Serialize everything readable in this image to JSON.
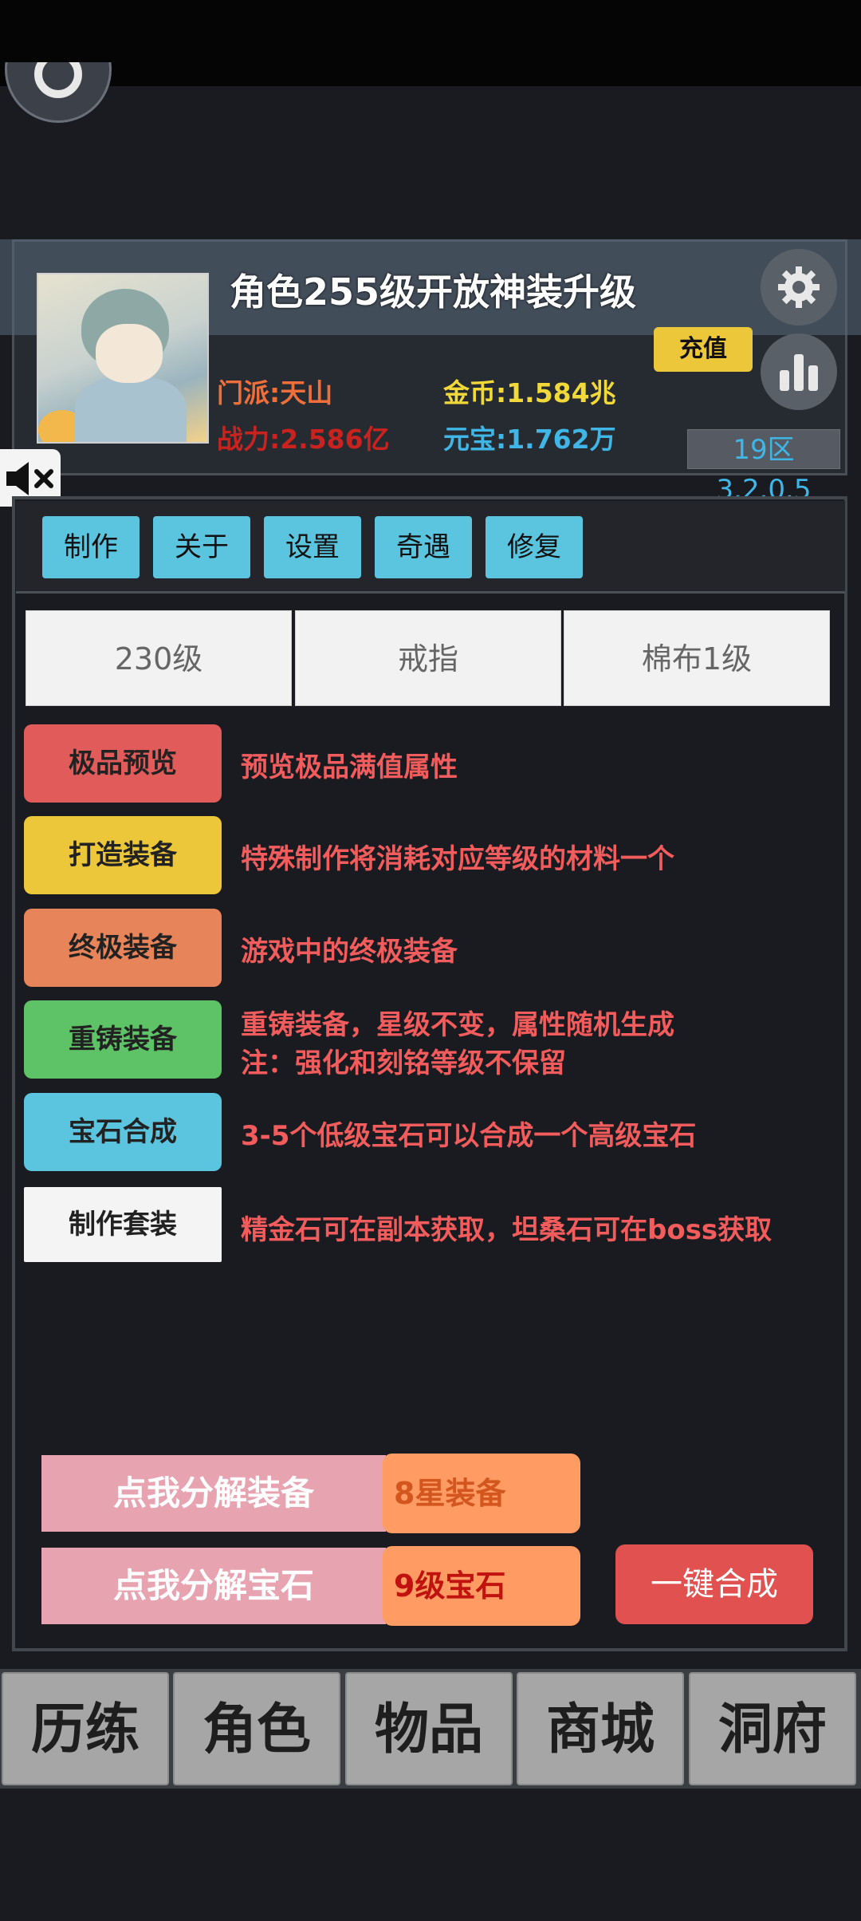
{
  "header": {
    "notice": "角色255级开放神装升级",
    "sect": "门派:天山",
    "gold": "金币:1.584兆",
    "power": "战力:2.586亿",
    "yuanbao": "元宝:1.762万",
    "recharge_label": "充值",
    "server": "19区3.2.0.5"
  },
  "menu_tabs": [
    "制作",
    "关于",
    "设置",
    "奇遇",
    "修复"
  ],
  "filters": [
    "230级",
    "戒指",
    "棉布1级"
  ],
  "actions": [
    {
      "label": "极品预览",
      "desc": "预览极品满值属性",
      "color": "#e25b5b"
    },
    {
      "label": "打造装备",
      "desc": "特殊制作将消耗对应等级的材料一个",
      "color": "#ecc73a"
    },
    {
      "label": "终极装备",
      "desc": "游戏中的终极装备",
      "color": "#e8845a"
    },
    {
      "label": "重铸装备",
      "desc": "重铸装备，星级不变，属性随机生成",
      "desc2": "注：强化和刻铭等级不保留",
      "color": "#5ec267"
    },
    {
      "label": "宝石合成",
      "desc": "3-5个低级宝石可以合成一个高级宝石",
      "color": "#5bc4de"
    },
    {
      "label": "制作套装",
      "desc": "精金石可在副本获取，坦桑石可在boss获取",
      "color": "#f4f4f4"
    }
  ],
  "decompose": {
    "equip_label": "点我分解装备",
    "equip_value": "8星装备",
    "gem_label": "点我分解宝石",
    "gem_value": "9级宝石",
    "one_click": "一键合成"
  },
  "bottom_nav": [
    "历练",
    "角色",
    "物品",
    "商城",
    "洞府"
  ],
  "colors": {
    "sect": "#ef6f3a",
    "gold": "#f2d93a",
    "power": "#c9231f",
    "yuanbao": "#3fb6e6",
    "equip_value": "#d2561e",
    "gem_value": "#c0120f"
  }
}
